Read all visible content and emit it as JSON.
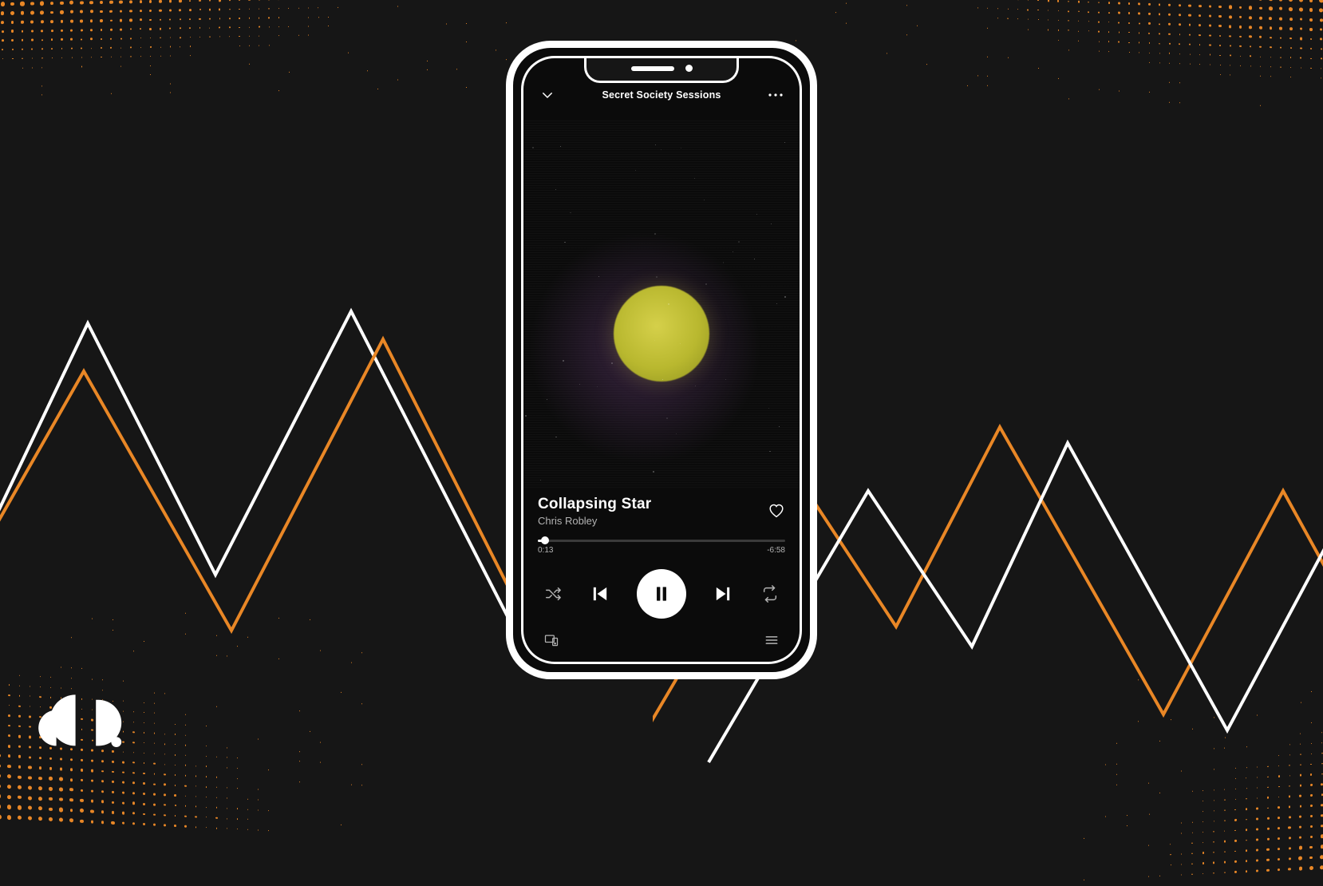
{
  "colors": {
    "accent": "#e98726",
    "bg": "#161616",
    "player_bg": "#0b0b0b"
  },
  "player": {
    "context_title": "Secret Society Sessions",
    "track_title": "Collapsing Star",
    "artist": "Chris Robley",
    "time_elapsed": "0:13",
    "time_remaining": "-6:58",
    "progress_percent": 3.0
  },
  "icons": {
    "chevron_down": "chevron-down-icon",
    "more": "more-icon",
    "heart": "heart-icon",
    "shuffle": "shuffle-icon",
    "prev": "previous-icon",
    "playpause": "pause-icon",
    "next": "next-icon",
    "repeat": "repeat-icon",
    "devices": "devices-icon",
    "queue": "queue-icon"
  },
  "brand": {
    "name": "cd-baby-logo"
  }
}
